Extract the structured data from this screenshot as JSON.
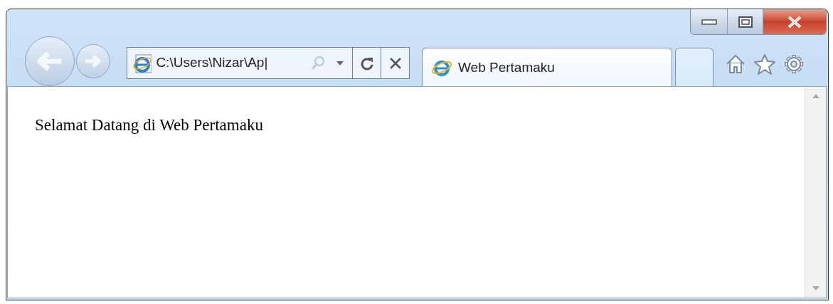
{
  "address_bar": {
    "value": "C:\\Users\\Nizar\\Ap|"
  },
  "tabs": [
    {
      "label": "Web Pertamaku",
      "selected": true
    }
  ],
  "page": {
    "text": "Selamat Datang di Web Pertamaku"
  }
}
